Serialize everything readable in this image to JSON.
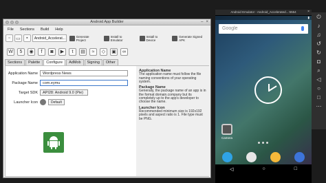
{
  "builder": {
    "title": "Android App Builder",
    "menu": [
      "File",
      "Sections",
      "Build",
      "Help"
    ],
    "project_select": "Android_Accelerat...",
    "toolbar_buttons": [
      {
        "label": "Generate Project"
      },
      {
        "label": "Install to Emulator"
      },
      {
        "label": "Install to Device"
      },
      {
        "label": "Generate Signed APK"
      }
    ],
    "tabs": [
      "Sections",
      "Palette",
      "Configure",
      "AdMob",
      "Signing",
      "Other"
    ],
    "form": {
      "app_name_label": "Application Name",
      "app_name_value": "Wordpress News",
      "package_label": "Package Name",
      "package_value": "com.eymu",
      "sdk_label": "Target SDK",
      "sdk_value": "API28: Android 9.0 (Pie)",
      "launcher_label": "Launcher Icon",
      "default_button": "Default"
    },
    "help": [
      {
        "title": "Application Name",
        "text": "The application name must follow the file naming conventions of your operating system."
      },
      {
        "title": "Package Name",
        "text": "Generally, the package name of an app is in the format domain.company but its completely up to the app's developer to choose the name."
      },
      {
        "title": "Launcher Icon",
        "text": "Recommended minimum size is 192x192 pixels and aspect ratio is 1. File type must be PNG."
      }
    ]
  },
  "emulator": {
    "title": "Android Emulator - Android_Accelerated...:5554",
    "search_text": "Google",
    "app_label": "Camera",
    "colors": {
      "accent": "#3b8e3e",
      "focus": "#3a76c9"
    }
  }
}
